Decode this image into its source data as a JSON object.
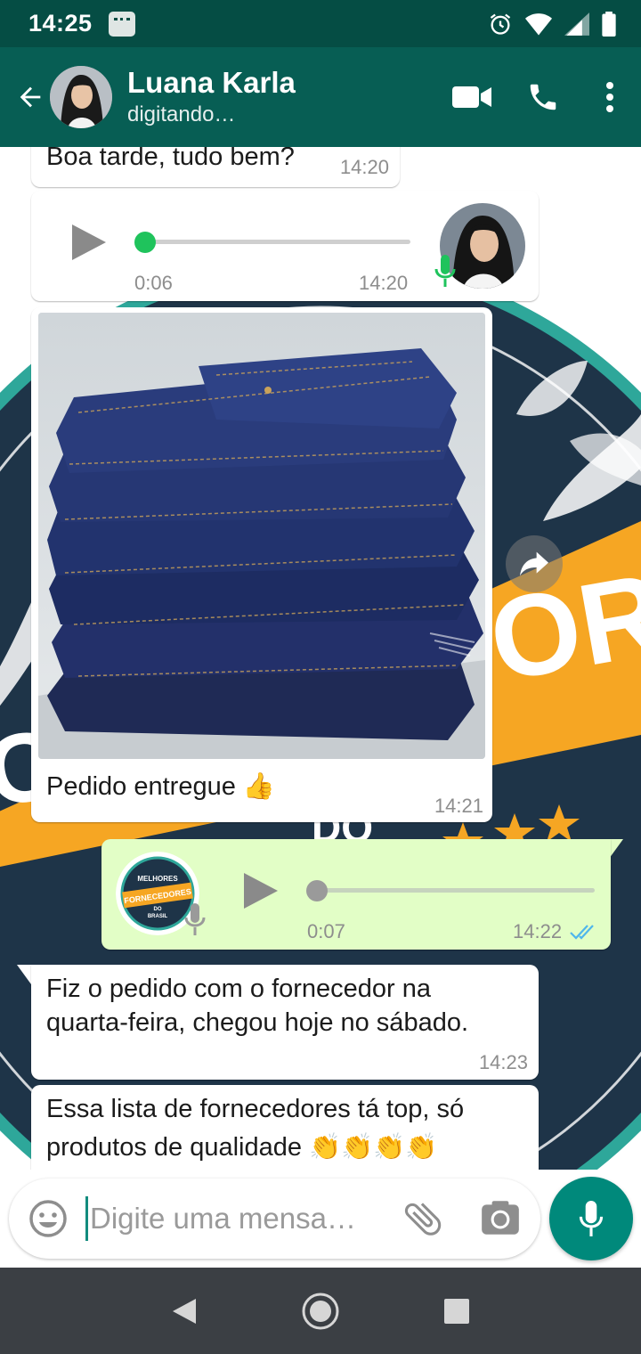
{
  "status_bar": {
    "time": "14:25"
  },
  "header": {
    "contact_name": "Luana Karla",
    "contact_status": "digitando…"
  },
  "messages": [
    {
      "type": "text",
      "direction": "incoming",
      "text": "Boa tarde, tudo bem?",
      "time": "14:20"
    },
    {
      "type": "voice",
      "direction": "incoming",
      "duration": "0:06",
      "time": "14:20",
      "progress": 0
    },
    {
      "type": "image",
      "direction": "incoming",
      "caption": "Pedido entregue 👍",
      "time": "14:21"
    },
    {
      "type": "voice",
      "direction": "outgoing",
      "duration": "0:07",
      "time": "14:22",
      "progress": 0,
      "read": true,
      "avatar_lines": [
        "MELHORES",
        "FORNECEDORES",
        "DO",
        "BRASIL"
      ]
    },
    {
      "type": "text",
      "direction": "incoming",
      "line1": "Fiz o pedido com o fornecedor na",
      "line2": "quarta-feira, chegou hoje no sábado.",
      "time": "14:23"
    },
    {
      "type": "text",
      "direction": "incoming",
      "line1": "Essa lista de fornecedores tá top, só",
      "line2": "produtos de qualidade 👏👏👏👏"
    }
  ],
  "wallpaper": {
    "banner_text": "ORE",
    "banner_text_left": "O",
    "small_text": "DO"
  },
  "composer": {
    "placeholder": "Digite uma mensa…"
  },
  "colors": {
    "header": "#075e54",
    "status_bar": "#054d44",
    "outgoing_bubble": "#e2fec6",
    "accent_green": "#1fc35c",
    "fab": "#00897b",
    "banner_orange": "#f6a623",
    "wallpaper_navy": "#1e3448",
    "read_ticks": "#4fb6ec"
  }
}
